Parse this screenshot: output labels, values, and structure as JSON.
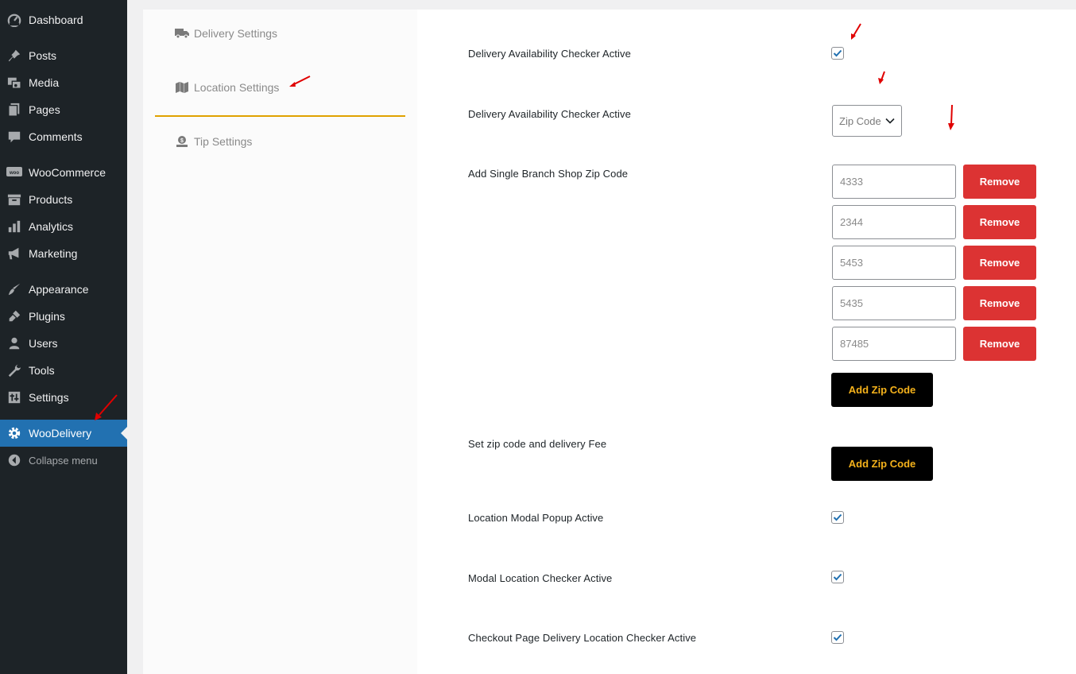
{
  "sidebar": {
    "items": [
      {
        "label": "Dashboard",
        "icon": "dashboard-icon"
      },
      {
        "label": "Posts",
        "icon": "pin-icon"
      },
      {
        "label": "Media",
        "icon": "media-icon"
      },
      {
        "label": "Pages",
        "icon": "pages-icon"
      },
      {
        "label": "Comments",
        "icon": "comment-icon"
      },
      {
        "label": "WooCommerce",
        "icon": "woo-icon"
      },
      {
        "label": "Products",
        "icon": "archive-icon"
      },
      {
        "label": "Analytics",
        "icon": "chart-icon"
      },
      {
        "label": "Marketing",
        "icon": "megaphone-icon"
      },
      {
        "label": "Appearance",
        "icon": "brush-icon"
      },
      {
        "label": "Plugins",
        "icon": "plug-icon"
      },
      {
        "label": "Users",
        "icon": "user-icon"
      },
      {
        "label": "Tools",
        "icon": "wrench-icon"
      },
      {
        "label": "Settings",
        "icon": "settings-icon"
      },
      {
        "label": "WooDelivery",
        "icon": "gear-icon"
      }
    ],
    "collapse_label": "Collapse menu",
    "active_color": "#2271b1",
    "background_color": "#1d2327"
  },
  "tabs": {
    "delivery": "Delivery Settings",
    "location": "Location Settings",
    "tip": "Tip Settings",
    "active": "Location Settings",
    "underline_color": "#e0a100"
  },
  "settings": {
    "availability_checker_label": "Delivery Availability Checker Active",
    "availability_checker_checked": true,
    "availability_type_label": "Delivery Availability Checker Active",
    "availability_type_value": "Zip Code",
    "single_branch_label": "Add Single Branch Shop Zip Code",
    "zip_codes": [
      "4333",
      "2344",
      "5453",
      "5435",
      "87485"
    ],
    "remove_label": "Remove",
    "add_zip_label": "Add Zip Code",
    "zip_fee_label": "Set zip code and delivery Fee",
    "modal_popup_label": "Location Modal Popup Active",
    "modal_popup_checked": true,
    "modal_checker_label": "Modal Location Checker Active",
    "modal_checker_checked": true,
    "checkout_checker_label": "Checkout Page Delivery Location Checker Active",
    "checkout_checker_checked": true
  },
  "colors": {
    "remove": "#dc3333",
    "add_button_bg": "#000000",
    "add_button_text": "#f5b21b",
    "checkmark": "#2271b1",
    "annotation_arrow": "#e00000"
  }
}
